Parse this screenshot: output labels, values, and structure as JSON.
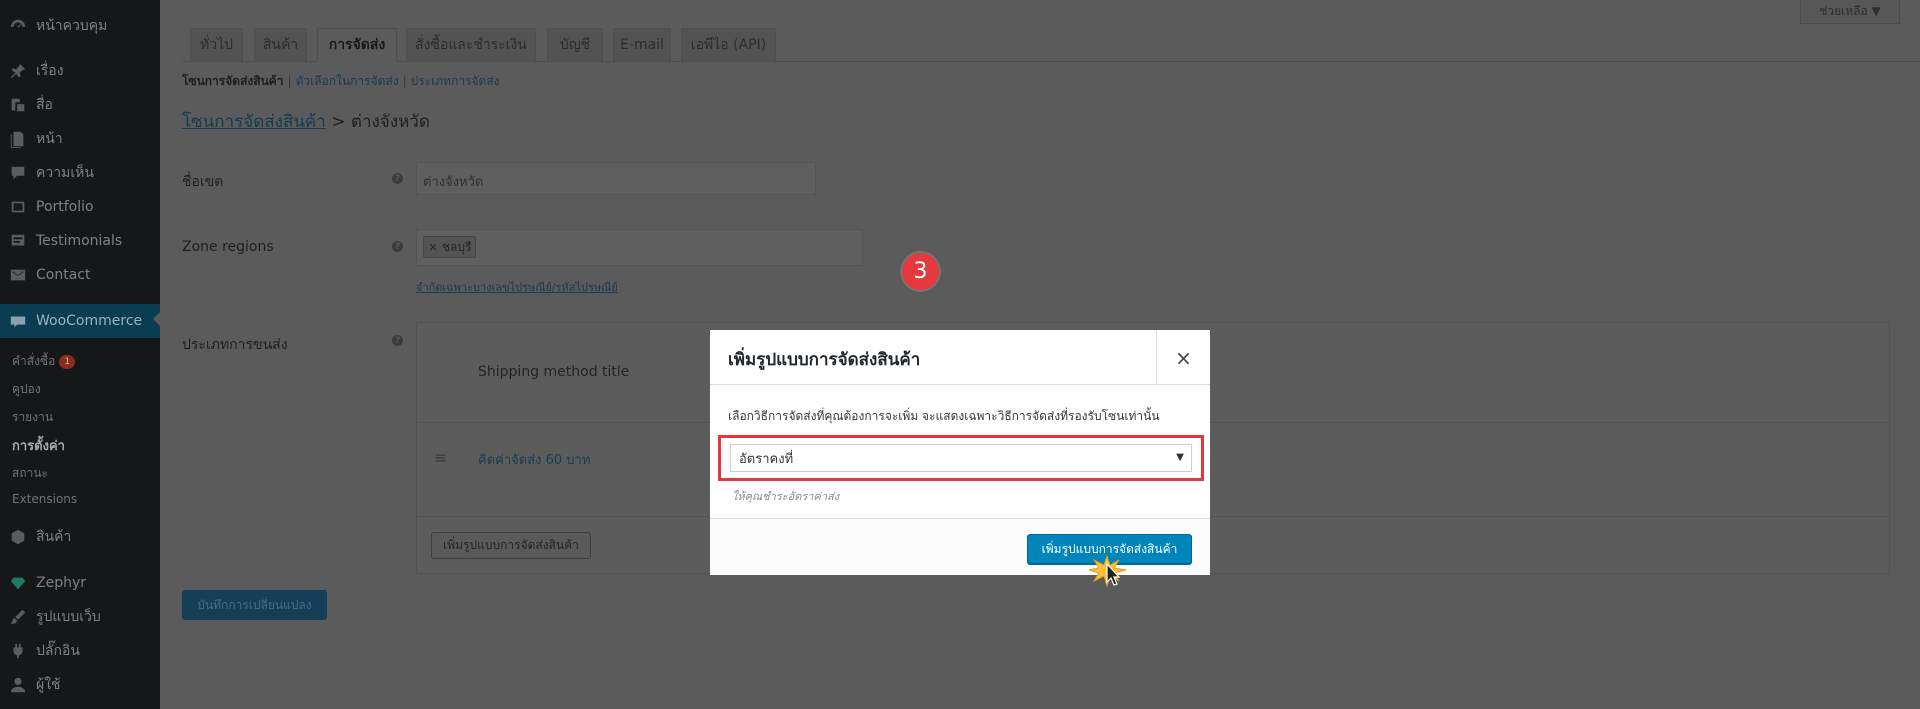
{
  "help_button": "ช่วยเหลือ ▼",
  "sidebar": {
    "items": [
      {
        "label": "หน้าควบคุม",
        "icon": "dashboard-icon"
      },
      {
        "label": "เรื่อง",
        "icon": "pin-icon"
      },
      {
        "label": "สื่อ",
        "icon": "media-icon"
      },
      {
        "label": "หน้า",
        "icon": "page-icon"
      },
      {
        "label": "ความเห็น",
        "icon": "comment-icon"
      },
      {
        "label": "Portfolio",
        "icon": "portfolio-icon"
      },
      {
        "label": "Testimonials",
        "icon": "testimonials-icon"
      },
      {
        "label": "Contact",
        "icon": "mail-icon"
      }
    ],
    "woocommerce": "WooCommerce",
    "submenu": {
      "orders": "คำสั่งซื้อ",
      "orders_badge": "1",
      "coupons": "คูปอง",
      "reports": "รายงาน",
      "settings": "การตั้งค่า",
      "status": "สถานะ",
      "extensions": "Extensions"
    },
    "bottom_items": [
      {
        "label": "สินค้า",
        "icon": "box-icon"
      },
      {
        "label": "Zephyr",
        "icon": "diamond-icon"
      },
      {
        "label": "รูปแบบเว็บ",
        "icon": "brush-icon"
      },
      {
        "label": "ปลั๊กอิน",
        "icon": "plugin-icon"
      },
      {
        "label": "ผู้ใช้",
        "icon": "user-icon"
      }
    ]
  },
  "tabs": [
    {
      "label": "ทั่วไป"
    },
    {
      "label": "สินค้า"
    },
    {
      "label": "การจัดส่ง",
      "active": true
    },
    {
      "label": "สั่งซื้อและชำระเงิน"
    },
    {
      "label": "บัญชี"
    },
    {
      "label": "E-mail"
    },
    {
      "label": "เอพีไอ (API)"
    }
  ],
  "subnav": {
    "current": "โซนการจัดส่งสินค้า",
    "options": "ตัวเลือกในการจัดส่ง",
    "classes": "ประเภทการจัดส่ง",
    "sep": "|"
  },
  "breadcrumb": {
    "link": "โซนการจัดส่งสินค้า",
    "sep": ">",
    "current": "ต่างจังหวัด"
  },
  "form": {
    "zone_name_label": "ชื่อเขต",
    "zone_name_value": "ต่างจังหวัด",
    "zone_regions_label": "Zone regions",
    "region_chip": "× ชลบุรี",
    "postcode_link": "จำกัดเฉพาะบางเลขไปรษณีย์/รหัสไปรษณีย์",
    "shipping_methods_label": "ประเภทการขนส่ง",
    "help_glyph": "?"
  },
  "methods_table": {
    "header_title": "Shipping method title",
    "drag_glyph": "≡",
    "row_title": "คิดค่าจัดส่ง 60 บาท",
    "add_button": "เพิ่มรูปแบบการจัดส่งสินค้า"
  },
  "save_button": "บันทึกการเปลี่ยนแปลง",
  "step_number": "3",
  "modal": {
    "title": "เพิ่มรูปแบบการจัดส่งสินค้า",
    "close": "×",
    "description": "เลือกวิธีการจัดส่งที่คุณต้องการจะเพิ่ม จะแสดงเฉพาะวิธีการจัดส่งที่รองรับโซนเท่านั้น",
    "select_value": "อัตราคงที่",
    "select_caret": "▼",
    "hint": "ให้คุณชำระอัตราค่าส่ง",
    "submit": "เพิ่มรูปแบบการจัดส่งสินค้า"
  },
  "colors": {
    "modal_primary": "#0085ba",
    "highlight": "#e2383b",
    "step_badge": "#e43a3d",
    "overlay_bg": "#5b5b5b"
  }
}
